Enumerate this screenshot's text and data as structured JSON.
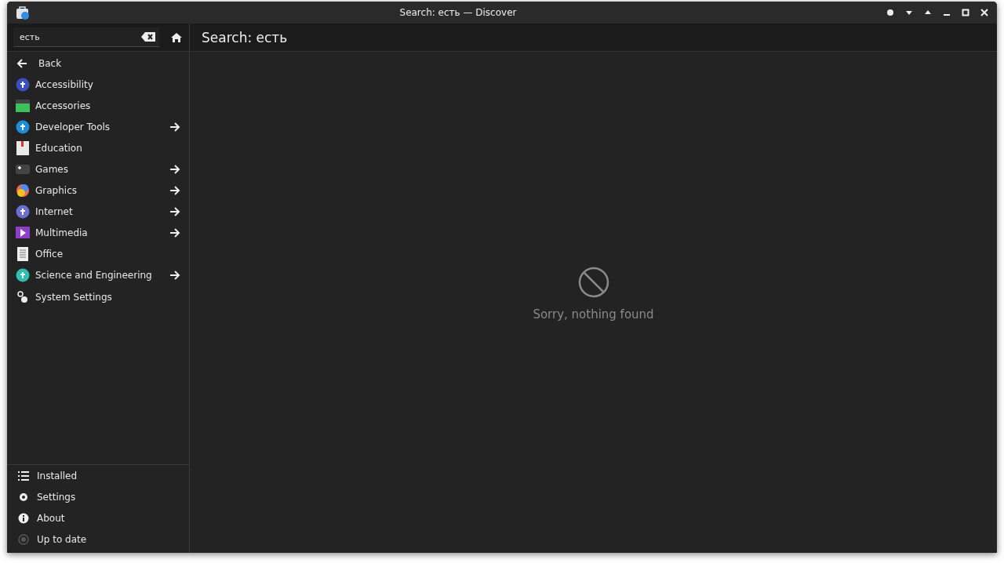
{
  "window": {
    "title": "Search: есть — Discover"
  },
  "search": {
    "value": "есть"
  },
  "back": {
    "label": "Back"
  },
  "categories": [
    {
      "label": "Accessibility",
      "has_children": false
    },
    {
      "label": "Accessories",
      "has_children": false
    },
    {
      "label": "Developer Tools",
      "has_children": true
    },
    {
      "label": "Education",
      "has_children": false
    },
    {
      "label": "Games",
      "has_children": true
    },
    {
      "label": "Graphics",
      "has_children": true
    },
    {
      "label": "Internet",
      "has_children": true
    },
    {
      "label": "Multimedia",
      "has_children": true
    },
    {
      "label": "Office",
      "has_children": false
    },
    {
      "label": "Science and Engineering",
      "has_children": true
    },
    {
      "label": "System Settings",
      "has_children": false
    }
  ],
  "footer": [
    {
      "label": "Installed"
    },
    {
      "label": "Settings"
    },
    {
      "label": "About"
    },
    {
      "label": "Up to date"
    }
  ],
  "page": {
    "title": "Search: есть",
    "message": "Sorry, nothing found"
  }
}
